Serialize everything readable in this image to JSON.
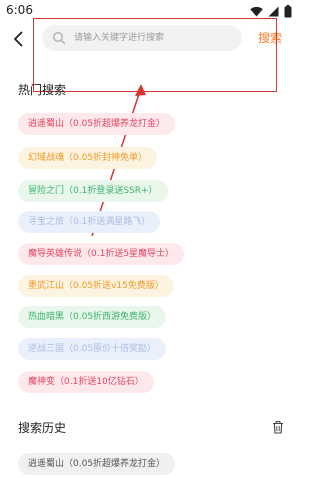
{
  "status_bar": {
    "time": "6:06",
    "icons": [
      "wifi-icon",
      "signal-icon",
      "battery-icon"
    ]
  },
  "header": {
    "back_icon": "back-arrow-icon",
    "search_placeholder": "请输入关键字进行搜索",
    "search_button": "搜索",
    "accent_color": "#ff7a1f"
  },
  "hot_search": {
    "title": "热门搜索",
    "tags": [
      {
        "label": "逍遥蜀山（0.05折超爆养龙打金）",
        "color": "red"
      },
      {
        "label": "幻域战魂（0.05折封神免单）",
        "color": "yellow"
      },
      {
        "label": "冒险之门（0.1折登录送SSR+）",
        "color": "green"
      },
      {
        "label": "寻宝之旅（0.1折送满星路飞）",
        "color": "blue"
      },
      {
        "label": "魔导英雄传说（0.1折送5星魔导士）",
        "color": "red"
      },
      {
        "label": "墨武江山（0.05折送v15免费版）",
        "color": "yellow"
      },
      {
        "label": "热血暗黑（0.05折西游免费版）",
        "color": "green"
      },
      {
        "label": "逆战三国（0.05原价十倍奖励）",
        "color": "blue"
      },
      {
        "label": "魔神变（0.1折送10亿钻石）",
        "color": "red"
      }
    ]
  },
  "history": {
    "title": "搜索历史",
    "clear_icon": "trash-icon",
    "items": [
      {
        "label": "逍遥蜀山（0.05折超爆养龙打金）"
      }
    ]
  },
  "annotation": {
    "color": "#d6362f"
  }
}
